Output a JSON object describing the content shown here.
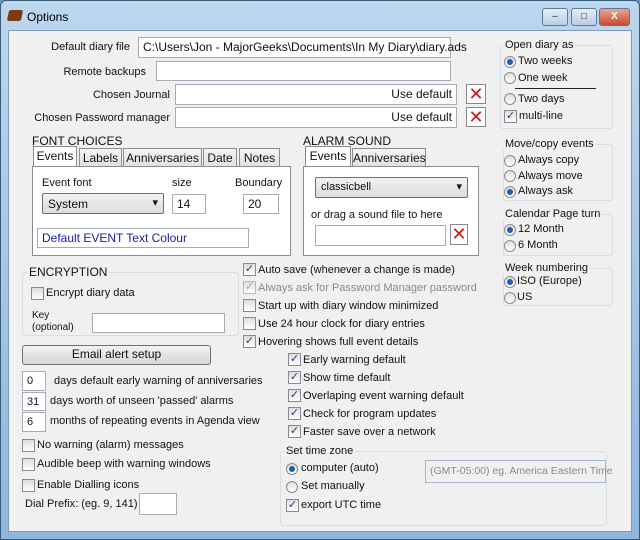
{
  "window": {
    "title": "Options",
    "minimize": "–",
    "maximize": "□",
    "close": "X"
  },
  "files": {
    "default_diary_label": "Default diary file",
    "default_diary_value": "C:\\Users\\Jon - MajorGeeks\\Documents\\In My Diary\\diary.ads",
    "remote_backups_label": "Remote backups",
    "remote_backups_value": "",
    "journal_label": "Chosen Journal",
    "journal_use_default": "Use default",
    "password_label": "Chosen Password manager",
    "password_use_default": "Use default",
    "clear_icon": "✕"
  },
  "open_diary": {
    "title": "Open diary as",
    "options": [
      "Two weeks",
      "One week",
      "Two days"
    ],
    "selected": "Two weeks",
    "multiline_label": "multi-line",
    "multiline_checked": true
  },
  "font": {
    "title": "FONT CHOICES",
    "tabs": [
      "Events",
      "Labels",
      "Anniversaries",
      "Date",
      "Notes"
    ],
    "active_tab": "Events",
    "event_font_label": "Event font",
    "size_label": "size",
    "boundary_label": "Boundary",
    "font_value": "System",
    "size_value": "14",
    "boundary_value": "20",
    "colour_button": "Default EVENT Text Colour",
    "colour": "#1a1aa8"
  },
  "alarm": {
    "title": "ALARM SOUND",
    "tabs": [
      "Events",
      "Anniversaries"
    ],
    "active_tab": "Events",
    "sound_value": "classicbell",
    "drag_label": "or drag a sound file to here",
    "drag_value": ""
  },
  "move_copy": {
    "title": "Move/copy events",
    "options": [
      "Always copy",
      "Always move",
      "Always ask"
    ],
    "selected": "Always ask"
  },
  "page_turn": {
    "title": "Calendar Page turn",
    "options": [
      "12 Month",
      "6 Month"
    ],
    "selected": "12 Month"
  },
  "week_numbering": {
    "title": "Week numbering",
    "options": [
      "ISO (Europe)",
      "US"
    ],
    "selected": "ISO (Europe)"
  },
  "encryption": {
    "title": "ENCRYPTION",
    "encrypt_label": "Encrypt diary data",
    "encrypt_checked": false,
    "key_label": "Key",
    "key_optional": "(optional)",
    "key_value": ""
  },
  "email_button": "Email alert setup",
  "numbers": [
    {
      "value": "0",
      "label": "days default early warning of anniversaries"
    },
    {
      "value": "31",
      "label": "days worth of unseen 'passed' alarms"
    },
    {
      "value": "6",
      "label": "months of repeating events in Agenda view"
    }
  ],
  "left_checks": [
    {
      "label": "No warning (alarm) messages",
      "checked": false
    },
    {
      "label": "Audible beep with warning windows",
      "checked": false
    },
    {
      "label": "Enable Dialling icons",
      "checked": false
    }
  ],
  "dial_prefix": {
    "label": "Dial Prefix: (eg. 9, 141)",
    "value": ""
  },
  "main_checks": [
    {
      "label": "Auto save (whenever a change is made)",
      "checked": true
    },
    {
      "label": "Always ask for Password Manager password",
      "checked": true,
      "disabled": true
    },
    {
      "label": "Start up with diary window minimized",
      "checked": false
    },
    {
      "label": "Use 24 hour clock for diary entries",
      "checked": false
    },
    {
      "label": "Hovering shows full event details",
      "checked": true
    }
  ],
  "sub_checks": [
    {
      "label": "Early warning default",
      "checked": true
    },
    {
      "label": "Show time default",
      "checked": true
    },
    {
      "label": "Overlaping event warning default",
      "checked": true
    },
    {
      "label": "Check for program updates",
      "checked": true
    },
    {
      "label": "Faster save over a network",
      "checked": true
    }
  ],
  "timezone": {
    "title": "Set time zone",
    "options": [
      "computer (auto)",
      "Set manually"
    ],
    "selected": "computer (auto)",
    "export_label": "export UTC time",
    "export_checked": true,
    "zone_value": "(GMT-05:00) eg. America Eastern Time"
  }
}
